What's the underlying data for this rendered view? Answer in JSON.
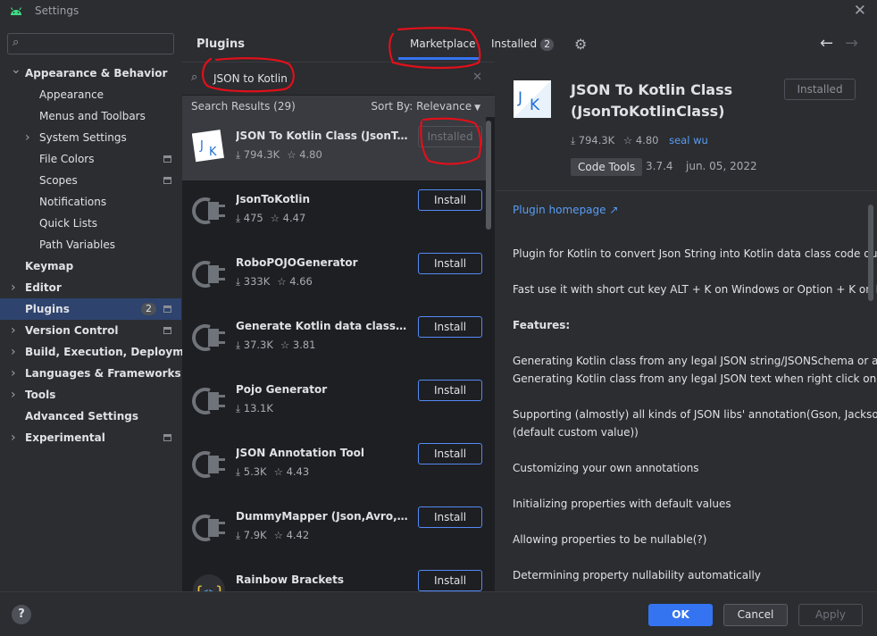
{
  "window": {
    "title": "Settings",
    "close_glyph": "✕"
  },
  "sidebar": {
    "search_placeholder": "",
    "items": [
      {
        "label": "Appearance & Behavior",
        "level": 0,
        "expandable": true,
        "expanded": true,
        "bold": true
      },
      {
        "label": "Appearance",
        "level": 1
      },
      {
        "label": "Menus and Toolbars",
        "level": 1
      },
      {
        "label": "System Settings",
        "level": 1,
        "expandable": true
      },
      {
        "label": "File Colors",
        "level": 1,
        "project": true
      },
      {
        "label": "Scopes",
        "level": 1,
        "project": true
      },
      {
        "label": "Notifications",
        "level": 1
      },
      {
        "label": "Quick Lists",
        "level": 1
      },
      {
        "label": "Path Variables",
        "level": 1
      },
      {
        "label": "Keymap",
        "level": 0,
        "bold": true
      },
      {
        "label": "Editor",
        "level": 0,
        "expandable": true,
        "bold": true
      },
      {
        "label": "Plugins",
        "level": 0,
        "bold": true,
        "selected": true,
        "count": "2",
        "project": true
      },
      {
        "label": "Version Control",
        "level": 0,
        "expandable": true,
        "bold": true,
        "project": true
      },
      {
        "label": "Build, Execution, Deployment",
        "level": 0,
        "expandable": true,
        "bold": true
      },
      {
        "label": "Languages & Frameworks",
        "level": 0,
        "expandable": true,
        "bold": true
      },
      {
        "label": "Tools",
        "level": 0,
        "expandable": true,
        "bold": true
      },
      {
        "label": "Advanced Settings",
        "level": 0,
        "bold": true
      },
      {
        "label": "Experimental",
        "level": 0,
        "expandable": true,
        "bold": true,
        "project": true
      }
    ]
  },
  "header": {
    "title": "Plugins",
    "tabs": {
      "marketplace": "Marketplace",
      "installed": "Installed",
      "installed_count": "2"
    },
    "gear_icon": "⚙",
    "back_glyph": "←",
    "forward_glyph": "→"
  },
  "search": {
    "value": "JSON to Kotlin",
    "clear_glyph": "✕"
  },
  "results": {
    "count_label": "Search Results (29)",
    "sort_label": "Sort By: Relevance"
  },
  "plugins": [
    {
      "name": "JSON To Kotlin Class (JsonToKotlinClass)",
      "downloads": "794.3K",
      "rating": "4.80",
      "button": "Installed",
      "installed": true,
      "selected": true,
      "icon": "jk-logo"
    },
    {
      "name": "JsonToKotlin",
      "downloads": "475",
      "rating": "4.47",
      "button": "Install",
      "icon": "plug-icon"
    },
    {
      "name": "RoboPOJOGenerator",
      "downloads": "333K",
      "rating": "4.66",
      "button": "Install",
      "icon": "plug-icon"
    },
    {
      "name": "Generate Kotlin data classes from JSON",
      "downloads": "37.3K",
      "rating": "3.81",
      "button": "Install",
      "icon": "plug-icon"
    },
    {
      "name": "Pojo Generator",
      "downloads": "13.1K",
      "rating": "",
      "button": "Install",
      "icon": "plug-icon"
    },
    {
      "name": "JSON Annotation Tool",
      "downloads": "5.3K",
      "rating": "4.43",
      "button": "Install",
      "icon": "plug-icon"
    },
    {
      "name": "DummyMapper (Json,Avro,GraphQL)",
      "downloads": "7.9K",
      "rating": "4.42",
      "button": "Install",
      "icon": "plug-icon"
    },
    {
      "name": "Rainbow Brackets",
      "downloads": "",
      "rating": "",
      "button": "Install",
      "icon": "rainbow-brackets-icon"
    }
  ],
  "detail": {
    "title": "JSON To Kotlin Class (JsonToKotlinClass)",
    "installed_button": "Installed",
    "downloads": "794.3K",
    "rating": "4.80",
    "vendor": "seal wu",
    "tag": "Code Tools",
    "version": "3.7.4",
    "date": "jun. 05, 2022",
    "homepage_link": "Plugin homepage ↗",
    "description": [
      {
        "text": "Plugin for Kotlin to convert Json String into Kotlin data class code quickly"
      },
      {
        "text": "Fast use it with short cut key ALT + K on Windows or Option + K on Mac"
      },
      {
        "text": "Features:",
        "bold": true
      },
      {
        "text": "Generating Kotlin class from any legal JSON string/JSONSchema or any URLs t"
      },
      {
        "text": "Generating Kotlin class from any legal JSON text when right click on directory"
      },
      {
        "text": "Supporting (almostly) all kinds of JSON libs' annotation(Gson, Jackson, Fastjs"
      },
      {
        "text": "(default custom value))"
      },
      {
        "text": "Customizing your own annotations"
      },
      {
        "text": "Initializing properties with default values"
      },
      {
        "text": "Allowing properties to be nullable(?)"
      },
      {
        "text": "Determining property nullability automatically"
      }
    ]
  },
  "footer": {
    "help": "?",
    "ok": "OK",
    "cancel": "Cancel",
    "apply": "Apply"
  },
  "colors": {
    "accent": "#3574f0",
    "link": "#589df6",
    "selection": "#2e436e",
    "annotation": "#e0101b"
  }
}
